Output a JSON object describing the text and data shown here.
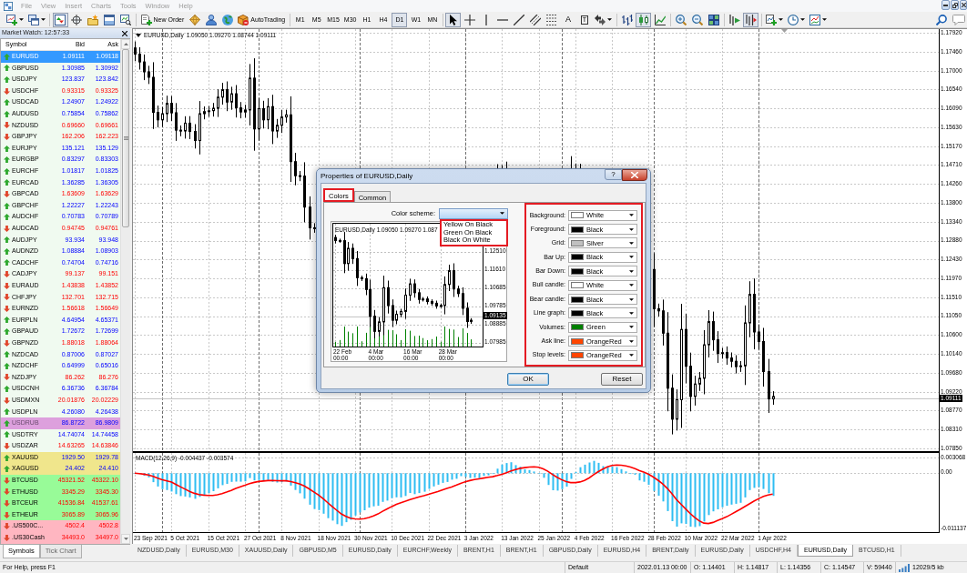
{
  "menu_bar": {
    "items": [
      {
        "label": "File",
        "disabled": true
      },
      {
        "label": "View",
        "disabled": true
      },
      {
        "label": "Insert",
        "disabled": true
      },
      {
        "label": "Charts",
        "disabled": true
      },
      {
        "label": "Tools",
        "disabled": true
      },
      {
        "label": "Window",
        "disabled": true
      },
      {
        "label": "Help",
        "disabled": true
      }
    ]
  },
  "toolbar": {
    "panel_buttons": [
      {
        "selected": true
      },
      {
        "selected": false
      },
      {
        "selected": false
      },
      {
        "selected": false
      },
      {
        "selected": false
      }
    ],
    "new_order": "New Order",
    "auto_trading": "AutoTrading",
    "timeframes": [
      {
        "label": "M1",
        "selected": false
      },
      {
        "label": "M5",
        "selected": false
      },
      {
        "label": "M15",
        "selected": false
      },
      {
        "label": "M30",
        "selected": false
      },
      {
        "label": "H1",
        "selected": false
      },
      {
        "label": "H4",
        "selected": false
      },
      {
        "label": "D1",
        "selected": true
      },
      {
        "label": "W1",
        "selected": false
      },
      {
        "label": "MN",
        "selected": false
      }
    ],
    "drawing_tools": [
      {
        "selected": true
      },
      {
        "selected": false
      },
      {
        "selected": false
      },
      {
        "selected": false
      },
      {
        "selected": false
      },
      {
        "selected": false
      },
      {
        "selected": false
      },
      {
        "label": "A",
        "selected": false
      },
      {
        "label": "T",
        "selected": false
      },
      {
        "selected": false
      }
    ],
    "chart_types": [
      {
        "selected": false
      },
      {
        "selected": true
      },
      {
        "selected": false
      }
    ],
    "chart_options": [
      {
        "selected": false
      },
      {
        "selected": true
      }
    ]
  },
  "market_watch": {
    "title": "Market Watch: 12:57:33",
    "columns": [
      "Symbol",
      "Bid",
      "Ask"
    ],
    "rows": [
      {
        "symbol": "EURUSD",
        "bid": "1.09111",
        "ask": "1.09118",
        "rising": true,
        "selected": true,
        "disabled": false
      },
      {
        "symbol": "GBPUSD",
        "bid": "1.30985",
        "ask": "1.30992",
        "rising": true,
        "selected": false,
        "disabled": false,
        "color": "#f0faf0"
      },
      {
        "symbol": "USDJPY",
        "bid": "123.837",
        "ask": "123.842",
        "rising": true,
        "selected": false,
        "disabled": false,
        "color": "#f0faf0"
      },
      {
        "symbol": "USDCHF",
        "bid": "0.93315",
        "ask": "0.93325",
        "rising": false,
        "selected": false,
        "disabled": false,
        "color": "#f0faf0"
      },
      {
        "symbol": "USDCAD",
        "bid": "1.24907",
        "ask": "1.24922",
        "rising": true,
        "selected": false,
        "disabled": false,
        "color": "#f0faf0"
      },
      {
        "symbol": "AUDUSD",
        "bid": "0.75854",
        "ask": "0.75862",
        "rising": true,
        "selected": false,
        "disabled": false,
        "color": "#f0faf0"
      },
      {
        "symbol": "NZDUSD",
        "bid": "0.69660",
        "ask": "0.69661",
        "rising": false,
        "selected": false,
        "disabled": false,
        "color": "#f0faf0"
      },
      {
        "symbol": "GBPJPY",
        "bid": "162.206",
        "ask": "162.223",
        "rising": false,
        "selected": false,
        "disabled": false,
        "color": "#f0faf0"
      },
      {
        "symbol": "EURJPY",
        "bid": "135.121",
        "ask": "135.129",
        "rising": true,
        "selected": false,
        "disabled": false,
        "color": "#f0faf0"
      },
      {
        "symbol": "EURGBP",
        "bid": "0.83297",
        "ask": "0.83303",
        "rising": true,
        "selected": false,
        "disabled": false,
        "color": "#f0faf0"
      },
      {
        "symbol": "EURCHF",
        "bid": "1.01817",
        "ask": "1.01825",
        "rising": true,
        "selected": false,
        "disabled": false,
        "color": "#f0faf0"
      },
      {
        "symbol": "EURCAD",
        "bid": "1.36285",
        "ask": "1.36305",
        "rising": true,
        "selected": false,
        "disabled": false,
        "color": "#f0faf0"
      },
      {
        "symbol": "GBPCAD",
        "bid": "1.63609",
        "ask": "1.63629",
        "rising": false,
        "selected": false,
        "disabled": false,
        "color": "#f0faf0"
      },
      {
        "symbol": "GBPCHF",
        "bid": "1.22227",
        "ask": "1.22243",
        "rising": true,
        "selected": false,
        "disabled": false,
        "color": "#f0faf0"
      },
      {
        "symbol": "AUDCHF",
        "bid": "0.70783",
        "ask": "0.70789",
        "rising": true,
        "selected": false,
        "disabled": false,
        "color": "#f0faf0"
      },
      {
        "symbol": "AUDCAD",
        "bid": "0.94745",
        "ask": "0.94761",
        "rising": false,
        "selected": false,
        "disabled": false,
        "color": "#f0faf0"
      },
      {
        "symbol": "AUDJPY",
        "bid": "93.934",
        "ask": "93.948",
        "rising": true,
        "selected": false,
        "disabled": false,
        "color": "#f0faf0"
      },
      {
        "symbol": "AUDNZD",
        "bid": "1.08884",
        "ask": "1.08903",
        "rising": true,
        "selected": false,
        "disabled": false,
        "color": "#f0faf0"
      },
      {
        "symbol": "CADCHF",
        "bid": "0.74704",
        "ask": "0.74716",
        "rising": true,
        "selected": false,
        "disabled": false,
        "color": "#f0faf0"
      },
      {
        "symbol": "CADJPY",
        "bid": "99.137",
        "ask": "99.151",
        "rising": false,
        "selected": false,
        "disabled": false,
        "color": "#f0faf0"
      },
      {
        "symbol": "EURAUD",
        "bid": "1.43838",
        "ask": "1.43852",
        "rising": false,
        "selected": false,
        "disabled": false,
        "color": "#f0faf0"
      },
      {
        "symbol": "CHFJPY",
        "bid": "132.701",
        "ask": "132.715",
        "rising": false,
        "selected": false,
        "disabled": false,
        "color": "#f0faf0"
      },
      {
        "symbol": "EURNZD",
        "bid": "1.56618",
        "ask": "1.56649",
        "rising": false,
        "selected": false,
        "disabled": false,
        "color": "#f0faf0"
      },
      {
        "symbol": "EURPLN",
        "bid": "4.64954",
        "ask": "4.65371",
        "rising": true,
        "selected": false,
        "disabled": false,
        "color": "#f0faf0"
      },
      {
        "symbol": "GBPAUD",
        "bid": "1.72672",
        "ask": "1.72699",
        "rising": true,
        "selected": false,
        "disabled": false,
        "color": "#f0faf0"
      },
      {
        "symbol": "GBPNZD",
        "bid": "1.88018",
        "ask": "1.88064",
        "rising": false,
        "selected": false,
        "disabled": false,
        "color": "#f0faf0"
      },
      {
        "symbol": "NZDCAD",
        "bid": "0.87006",
        "ask": "0.87027",
        "rising": true,
        "selected": false,
        "disabled": false,
        "color": "#f0faf0"
      },
      {
        "symbol": "NZDCHF",
        "bid": "0.64999",
        "ask": "0.65016",
        "rising": true,
        "selected": false,
        "disabled": false,
        "color": "#f0faf0"
      },
      {
        "symbol": "NZDJPY",
        "bid": "86.262",
        "ask": "86.276",
        "rising": false,
        "selected": false,
        "disabled": false,
        "color": "#f0faf0"
      },
      {
        "symbol": "USDCNH",
        "bid": "6.36736",
        "ask": "6.36784",
        "rising": true,
        "selected": false,
        "disabled": false,
        "color": "#f0faf0"
      },
      {
        "symbol": "USDMXN",
        "bid": "20.01876",
        "ask": "20.02229",
        "rising": false,
        "selected": false,
        "disabled": false,
        "color": "#f0faf0"
      },
      {
        "symbol": "USDPLN",
        "bid": "4.26080",
        "ask": "4.26438",
        "rising": true,
        "selected": false,
        "disabled": false,
        "color": "#f0faf0"
      },
      {
        "symbol": "USDRUB",
        "bid": "86.8722",
        "ask": "86.9809",
        "rising": true,
        "selected": false,
        "disabled": true,
        "color": "#dda0dd"
      },
      {
        "symbol": "USDTRY",
        "bid": "14.74074",
        "ask": "14.74458",
        "rising": true,
        "selected": false,
        "disabled": false,
        "color": "#f0faf0"
      },
      {
        "symbol": "USDZAR",
        "bid": "14.63265",
        "ask": "14.63846",
        "rising": false,
        "selected": false,
        "disabled": false,
        "color": "#f0faf0"
      },
      {
        "symbol": "XAUUSD",
        "bid": "1929.50",
        "ask": "1929.78",
        "rising": true,
        "selected": false,
        "disabled": false,
        "color": "#f0e68c"
      },
      {
        "symbol": "XAGUSD",
        "bid": "24.402",
        "ask": "24.410",
        "rising": true,
        "selected": false,
        "disabled": false,
        "color": "#f0e68c"
      },
      {
        "symbol": "BTCUSD",
        "bid": "45321.52",
        "ask": "45322.10",
        "rising": false,
        "selected": false,
        "disabled": false,
        "color": "#98fb98"
      },
      {
        "symbol": "ETHUSD",
        "bid": "3345.29",
        "ask": "3345.30",
        "rising": false,
        "selected": false,
        "disabled": false,
        "color": "#98fb98"
      },
      {
        "symbol": "BTCEUR",
        "bid": "41536.84",
        "ask": "41537.61",
        "rising": false,
        "selected": false,
        "disabled": false,
        "color": "#98fb98"
      },
      {
        "symbol": "ETHEUR",
        "bid": "3065.89",
        "ask": "3065.96",
        "rising": false,
        "selected": false,
        "disabled": false,
        "color": "#98fb98"
      },
      {
        "symbol": ".US500C...",
        "bid": "4502.4",
        "ask": "4502.8",
        "rising": false,
        "selected": false,
        "disabled": false,
        "color": "#ffb6c1"
      },
      {
        "symbol": ".US30Cash",
        "bid": "34493.0",
        "ask": "34497.0",
        "rising": false,
        "selected": false,
        "disabled": false,
        "color": "#ffb6c1"
      }
    ]
  },
  "left_tabs": [
    {
      "label": "Symbols",
      "selected": true
    },
    {
      "label": "Tick Chart",
      "selected": false
    }
  ],
  "chart": {
    "symbol": "EURUSD,Daily",
    "ohlc": "1.09050 1.09270 1.08744 1.09111",
    "price_axis": [
      "1.17920",
      "1.17460",
      "1.17000",
      "1.16540",
      "1.16090",
      "1.15630",
      "1.15170",
      "1.14710",
      "1.14260",
      "1.13800",
      "1.13340",
      "1.12880",
      "1.12430",
      "1.11970",
      "1.11510",
      "1.11050",
      "1.10600",
      "1.10140",
      "1.09680",
      "1.09220",
      "1.08770",
      "1.08310",
      "1.07850"
    ],
    "price_label": "1.09111",
    "date_axis": [
      "23 Sep 2021",
      "5 Oct 2021",
      "15 Oct 2021",
      "27 Oct 2021",
      "8 Nov 2021",
      "18 Nov 2021",
      "30 Nov 2021",
      "10 Dec 2021",
      "22 Dec 2021",
      "3 Jan 2022",
      "13 Jan 2022",
      "25 Jan 2022",
      "4 Feb 2022",
      "16 Feb 2022",
      "28 Feb 2022",
      "10 Mar 2022",
      "22 Mar 2022",
      "1 Apr 2022"
    ],
    "macd": {
      "label": "MACD(12,26,9) -0.004437 -0.003574",
      "axis": [
        "0.003068",
        "0.00",
        "-0.011137"
      ]
    }
  },
  "chart_tabs": [
    {
      "label": "NZDUSD,Daily",
      "selected": false
    },
    {
      "label": "EURUSD,M30",
      "selected": false
    },
    {
      "label": "XAUUSD,Daily",
      "selected": false
    },
    {
      "label": "GBPUSD,M5",
      "selected": false
    },
    {
      "label": "EURUSD,Daily",
      "selected": false
    },
    {
      "label": "EURCHF,Weekly",
      "selected": false
    },
    {
      "label": "BRENT,H1",
      "selected": false
    },
    {
      "label": "BRENT,H1",
      "selected": false
    },
    {
      "label": "GBPUSD,Daily",
      "selected": false
    },
    {
      "label": "EURUSD,H4",
      "selected": false
    },
    {
      "label": "BRENT,Daily",
      "selected": false
    },
    {
      "label": "EURUSD,Daily",
      "selected": false
    },
    {
      "label": "USDCHF,H4",
      "selected": false
    },
    {
      "label": "EURUSD,Daily",
      "selected": true
    },
    {
      "label": "BTCUSD,H1",
      "selected": false
    }
  ],
  "status_bar": {
    "help": "For Help, press F1",
    "profile": "Default",
    "bar_time": "2022.01.13 00:00",
    "open": "O: 1.14401",
    "high": "H: 1.14817",
    "low": "L: 1.14356",
    "close": "C: 1.14547",
    "volume": "V: 59440",
    "traffic": "12029/5 kb"
  },
  "dialog": {
    "title": "Properties of EURUSD,Daily",
    "help_button": "?",
    "tabs": [
      {
        "label": "Colors",
        "selected": true,
        "highlighted": true
      },
      {
        "label": "Common",
        "selected": false,
        "highlighted": false
      }
    ],
    "color_scheme": {
      "label": "Color scheme:",
      "expanded": true,
      "highlighted": true,
      "options": [
        "Yellow On Black",
        "Green On Black",
        "Black On White"
      ]
    },
    "preview": {
      "symbol": "EURUSD,Daily",
      "ohlc": "1.09050 1.09270 1.087",
      "price_axis": [
        "1.12510",
        "1.11610",
        "1.10685",
        "1.09785",
        "1.08885",
        "1.07985"
      ],
      "price_label": "1.09135",
      "date_axis": [
        "22 Feb 00:00",
        "4 Mar 00:00",
        "16 Mar 00:00",
        "28 Mar 00:00"
      ]
    },
    "settings": {
      "highlighted": true,
      "items": [
        {
          "label": "Background:",
          "value": "White",
          "color": "#ffffff"
        },
        {
          "label": "Foreground:",
          "value": "Black",
          "color": "#000000"
        },
        {
          "label": "Grid:",
          "value": "Silver",
          "color": "#c0c0c0"
        },
        {
          "label": "Bar Up:",
          "value": "Black",
          "color": "#000000"
        },
        {
          "label": "Bar Down:",
          "value": "Black",
          "color": "#000000"
        },
        {
          "label": "Bull candle:",
          "value": "White",
          "color": "#ffffff"
        },
        {
          "label": "Bear candle:",
          "value": "Black",
          "color": "#000000"
        },
        {
          "label": "Line graph:",
          "value": "Black",
          "color": "#000000"
        },
        {
          "label": "Volumes:",
          "value": "Green",
          "color": "#008000"
        },
        {
          "label": "Ask line:",
          "value": "OrangeRed",
          "color": "#ff4500"
        },
        {
          "label": "Stop levels:",
          "value": "OrangeRed",
          "color": "#ff4500"
        }
      ]
    },
    "buttons": [
      {
        "label": "OK",
        "default": true
      },
      {
        "label": "Reset",
        "default": false
      }
    ]
  }
}
